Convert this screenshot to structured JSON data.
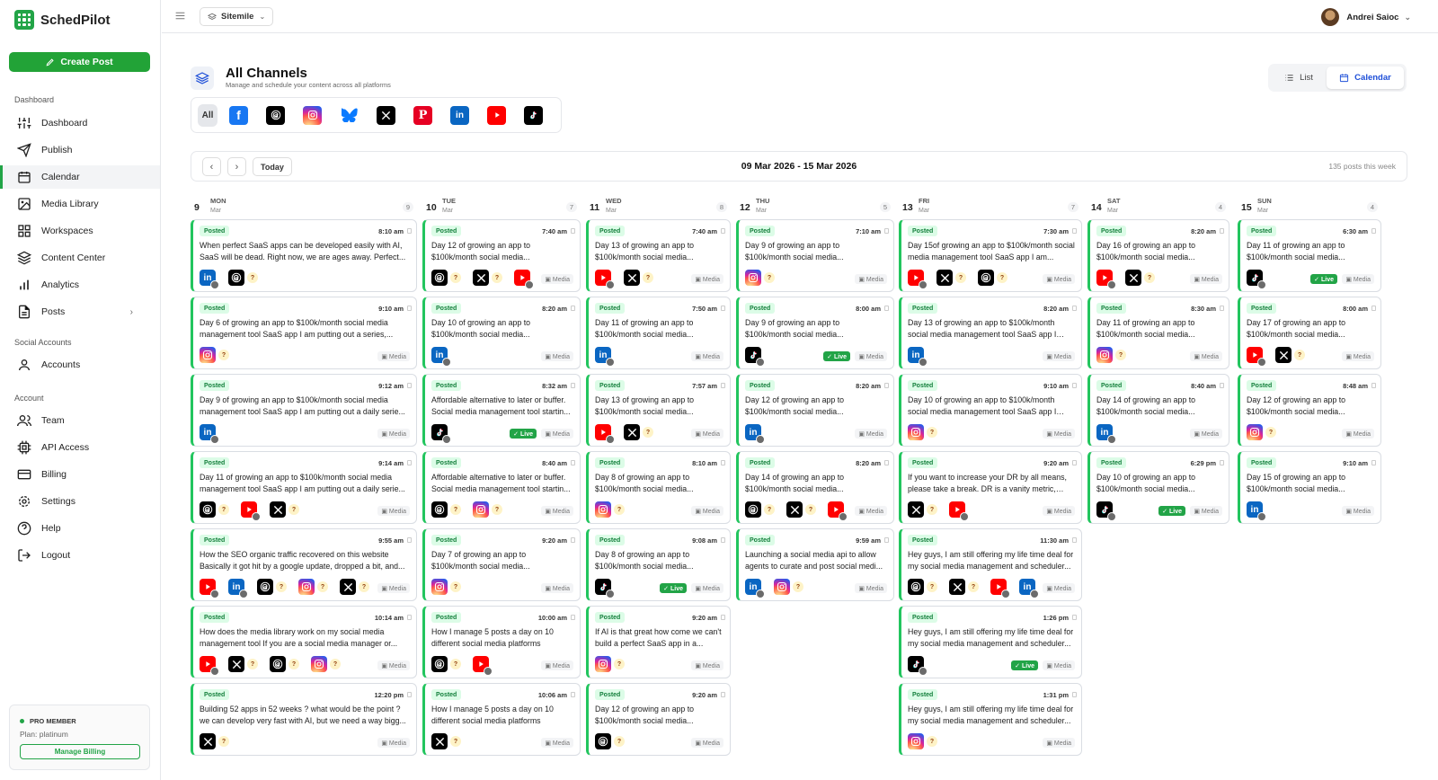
{
  "app": {
    "name": "SchedPilot",
    "create_label": "Create Post"
  },
  "nav": {
    "sections": [
      {
        "label": "Dashboard",
        "items": [
          {
            "key": "dashboard",
            "label": "Dashboard",
            "icon": "sliders-icon"
          },
          {
            "key": "publish",
            "label": "Publish",
            "icon": "send-icon"
          },
          {
            "key": "calendar",
            "label": "Calendar",
            "icon": "calendar-icon",
            "active": true
          },
          {
            "key": "media",
            "label": "Media Library",
            "icon": "image-icon"
          },
          {
            "key": "workspaces",
            "label": "Workspaces",
            "icon": "grid-icon"
          },
          {
            "key": "content",
            "label": "Content Center",
            "icon": "layers-icon"
          },
          {
            "key": "analytics",
            "label": "Analytics",
            "icon": "bar-chart-icon"
          },
          {
            "key": "posts",
            "label": "Posts",
            "icon": "file-icon",
            "chevron": true
          }
        ]
      },
      {
        "label": "Social Accounts",
        "items": [
          {
            "key": "accounts",
            "label": "Accounts",
            "icon": "user-icon"
          }
        ]
      },
      {
        "label": "Account",
        "items": [
          {
            "key": "team",
            "label": "Team",
            "icon": "users-icon"
          },
          {
            "key": "api",
            "label": "API Access",
            "icon": "cpu-icon"
          },
          {
            "key": "billing",
            "label": "Billing",
            "icon": "credit-card-icon"
          },
          {
            "key": "settings",
            "label": "Settings",
            "icon": "settings-icon"
          },
          {
            "key": "help",
            "label": "Help",
            "icon": "help-icon"
          },
          {
            "key": "logout",
            "label": "Logout",
            "icon": "logout-icon"
          }
        ]
      }
    ]
  },
  "pro": {
    "title": "PRO MEMBER",
    "plan": "Plan: platinum",
    "button": "Manage Billing"
  },
  "topbar": {
    "workspace": "Sitemile",
    "user": "Andrei Saioc"
  },
  "page": {
    "title": "All Channels",
    "subtitle": "Manage and schedule your content across all platforms"
  },
  "view": {
    "list": "List",
    "calendar": "Calendar",
    "active": "calendar"
  },
  "platforms": {
    "all_label": "All",
    "items": [
      "facebook",
      "threads",
      "instagram",
      "bluesky",
      "x",
      "pinterest",
      "linkedin",
      "youtube",
      "tiktok"
    ]
  },
  "calendar": {
    "today": "Today",
    "range": "09 Mar 2026 - 15 Mar 2026",
    "count": "135 posts this week"
  },
  "labels": {
    "posted": "Posted",
    "media": "Media",
    "live": "Live",
    "q": "?"
  },
  "colors": {
    "accent": "#22a447",
    "link": "#1d4ed8"
  },
  "days": [
    {
      "num": "9",
      "name": "MON",
      "month": "Mar",
      "count": "9",
      "posts": [
        {
          "time": "8:10 am",
          "text": "When perfect SaaS apps can be developed easily with AI, SaaS will be dead. Right now, we are ages away. Perfect...",
          "icons": [
            {
              "p": "linkedin",
              "a": true
            },
            {
              "p": "threads",
              "q": true
            }
          ],
          "media": false,
          "live": false
        },
        {
          "time": "9:10 am",
          "text": "Day 6 of growing an app to $100k/month social media management tool SaaS app I am putting out a series,...",
          "icons": [
            {
              "p": "instagram",
              "q": true
            }
          ],
          "media": true,
          "live": false
        },
        {
          "time": "9:12 am",
          "text": "Day 9 of growing an app to $100k/month social media management tool SaaS app I am putting out a daily serie...",
          "icons": [
            {
              "p": "linkedin",
              "a": true
            }
          ],
          "media": true,
          "live": false
        },
        {
          "time": "9:14 am",
          "text": "Day 11 of growing an app to $100k/month social media management tool SaaS app I am putting out a daily serie...",
          "icons": [
            {
              "p": "threads",
              "q": true
            },
            {
              "p": "youtube",
              "a": true
            },
            {
              "p": "x",
              "q": true
            }
          ],
          "media": true,
          "live": false
        },
        {
          "time": "9:55 am",
          "text": "How the SEO organic traffic recovered on this website Basically it got hit by a google update, dropped a bit, and...",
          "icons": [
            {
              "p": "youtube",
              "a": true
            },
            {
              "p": "linkedin",
              "a": true
            },
            {
              "p": "threads",
              "q": true
            },
            {
              "p": "instagram",
              "q": true
            },
            {
              "p": "x",
              "q": true
            }
          ],
          "media": true,
          "live": false
        },
        {
          "time": "10:14 am",
          "text": "How does the media library work on my social media management tool If you are a social media manager or...",
          "icons": [
            {
              "p": "youtube",
              "a": true
            },
            {
              "p": "x",
              "q": true
            },
            {
              "p": "threads",
              "q": true
            },
            {
              "p": "instagram",
              "q": true
            }
          ],
          "media": true,
          "live": false
        },
        {
          "time": "12:20 pm",
          "text": "Building 52 apps in 52 weeks ? what would be the point ? we can develop very fast with AI, but we need a way bigg...",
          "icons": [
            {
              "p": "x",
              "q": true
            }
          ],
          "media": true,
          "live": false
        }
      ]
    },
    {
      "num": "10",
      "name": "TUE",
      "month": "Mar",
      "count": "7",
      "posts": [
        {
          "time": "7:40 am",
          "text": "Day 12 of growing an app to $100k/month social media...",
          "icons": [
            {
              "p": "threads",
              "q": true
            },
            {
              "p": "x",
              "q": true
            },
            {
              "p": "youtube",
              "a": true
            }
          ],
          "media": true,
          "live": false
        },
        {
          "time": "8:20 am",
          "text": "Day 10 of growing an app to $100k/month social media...",
          "icons": [
            {
              "p": "linkedin",
              "a": true
            }
          ],
          "media": true,
          "live": false
        },
        {
          "time": "8:32 am",
          "text": "Affordable alternative to later or buffer. Social media management tool startin...",
          "icons": [
            {
              "p": "tiktok",
              "a": true
            }
          ],
          "media": true,
          "live": true
        },
        {
          "time": "8:40 am",
          "text": "Affordable alternative to later or buffer. Social media management tool startin...",
          "icons": [
            {
              "p": "threads",
              "q": true
            },
            {
              "p": "instagram",
              "q": true
            }
          ],
          "media": true,
          "live": false
        },
        {
          "time": "9:20 am",
          "text": "Day 7 of growing an app to $100k/month social media...",
          "icons": [
            {
              "p": "instagram",
              "q": true
            }
          ],
          "media": true,
          "live": false
        },
        {
          "time": "10:00 am",
          "text": "How I manage 5 posts a day on 10 different social media platforms",
          "icons": [
            {
              "p": "threads",
              "q": true
            },
            {
              "p": "youtube",
              "a": true
            }
          ],
          "media": true,
          "live": false
        },
        {
          "time": "10:06 am",
          "text": "How I manage 5 posts a day on 10 different social media platforms",
          "icons": [
            {
              "p": "x",
              "q": true
            }
          ],
          "media": true,
          "live": false
        }
      ]
    },
    {
      "num": "11",
      "name": "WED",
      "month": "Mar",
      "count": "8",
      "posts": [
        {
          "time": "7:40 am",
          "text": "Day 13 of growing an app to $100k/month social media...",
          "icons": [
            {
              "p": "youtube",
              "a": true
            },
            {
              "p": "x",
              "q": true
            }
          ],
          "media": true,
          "live": false
        },
        {
          "time": "7:50 am",
          "text": "Day 11 of growing an app to $100k/month social media...",
          "icons": [
            {
              "p": "linkedin",
              "a": true
            }
          ],
          "media": true,
          "live": false
        },
        {
          "time": "7:57 am",
          "text": "Day 13 of growing an app to $100k/month social media...",
          "icons": [
            {
              "p": "youtube",
              "a": true
            },
            {
              "p": "x",
              "q": true
            }
          ],
          "media": true,
          "live": false
        },
        {
          "time": "8:10 am",
          "text": "Day 8 of growing an app to $100k/month social media...",
          "icons": [
            {
              "p": "instagram",
              "q": true
            }
          ],
          "media": true,
          "live": false
        },
        {
          "time": "9:08 am",
          "text": "Day 8 of growing an app to $100k/month social media...",
          "icons": [
            {
              "p": "tiktok",
              "a": true
            }
          ],
          "media": true,
          "live": true
        },
        {
          "time": "9:20 am",
          "text": "If AI is that great how come we can't build a perfect SaaS app in a...",
          "icons": [
            {
              "p": "instagram",
              "q": true
            }
          ],
          "media": true,
          "live": false
        },
        {
          "time": "9:20 am",
          "text": "Day 12 of growing an app to $100k/month social media...",
          "icons": [
            {
              "p": "threads",
              "q": true
            }
          ],
          "media": true,
          "live": false
        }
      ]
    },
    {
      "num": "12",
      "name": "THU",
      "month": "Mar",
      "count": "5",
      "posts": [
        {
          "time": "7:10 am",
          "text": "Day 9 of growing an app to $100k/month social media...",
          "icons": [
            {
              "p": "instagram",
              "q": true
            }
          ],
          "media": true,
          "live": false
        },
        {
          "time": "8:00 am",
          "text": "Day 9 of growing an app to $100k/month social media...",
          "icons": [
            {
              "p": "tiktok",
              "a": true
            }
          ],
          "media": true,
          "live": true
        },
        {
          "time": "8:20 am",
          "text": "Day 12 of growing an app to $100k/month social media...",
          "icons": [
            {
              "p": "linkedin",
              "a": true
            }
          ],
          "media": true,
          "live": false
        },
        {
          "time": "8:20 am",
          "text": "Day 14 of growing an app to $100k/month social media...",
          "icons": [
            {
              "p": "threads",
              "q": true
            },
            {
              "p": "x",
              "q": true
            },
            {
              "p": "youtube",
              "a": true
            }
          ],
          "media": true,
          "live": false
        },
        {
          "time": "9:59 am",
          "text": "Launching a social media api to allow agents to curate and post social medi...",
          "icons": [
            {
              "p": "linkedin",
              "a": true
            },
            {
              "p": "instagram",
              "q": true
            }
          ],
          "media": true,
          "live": false
        }
      ]
    },
    {
      "num": "13",
      "name": "FRI",
      "month": "Mar",
      "count": "7",
      "posts": [
        {
          "time": "7:30 am",
          "text": "Day 15of growing an app to $100k/month social media management tool SaaS app I am...",
          "icons": [
            {
              "p": "youtube",
              "a": true
            },
            {
              "p": "x",
              "q": true
            },
            {
              "p": "threads",
              "q": true
            }
          ],
          "media": true,
          "live": false
        },
        {
          "time": "8:20 am",
          "text": "Day 13 of growing an app to $100k/month social media management tool SaaS app I am...",
          "icons": [
            {
              "p": "linkedin",
              "a": true
            }
          ],
          "media": true,
          "live": false
        },
        {
          "time": "9:10 am",
          "text": "Day 10 of growing an app to $100k/month social media management tool SaaS app I am...",
          "icons": [
            {
              "p": "instagram",
              "q": true
            }
          ],
          "media": true,
          "live": false
        },
        {
          "time": "9:20 am",
          "text": "If you want to increase your DR by all means, please take a break. DR is a vanity metric, and...",
          "icons": [
            {
              "p": "x",
              "q": true
            },
            {
              "p": "youtube",
              "a": true
            }
          ],
          "media": true,
          "live": false
        },
        {
          "time": "11:30 am",
          "text": "Hey guys, I am still offering my life time deal for my social media management and scheduler...",
          "icons": [
            {
              "p": "threads",
              "q": true
            },
            {
              "p": "x",
              "q": true
            },
            {
              "p": "youtube",
              "a": true
            },
            {
              "p": "linkedin",
              "a": true
            }
          ],
          "media": true,
          "live": false
        },
        {
          "time": "1:26 pm",
          "text": "Hey guys, I am still offering my life time deal for my social media management and scheduler...",
          "icons": [
            {
              "p": "tiktok",
              "a": true
            }
          ],
          "media": true,
          "live": true
        },
        {
          "time": "1:31 pm",
          "text": "Hey guys, I am still offering my life time deal for my social media management and scheduler...",
          "icons": [
            {
              "p": "instagram",
              "q": true
            }
          ],
          "media": true,
          "live": false
        }
      ]
    },
    {
      "num": "14",
      "name": "SAT",
      "month": "Mar",
      "count": "4",
      "posts": [
        {
          "time": "8:20 am",
          "text": "Day 16 of growing an app to $100k/month social media...",
          "icons": [
            {
              "p": "youtube",
              "a": true
            },
            {
              "p": "x",
              "q": true
            }
          ],
          "media": true,
          "live": false
        },
        {
          "time": "8:30 am",
          "text": "Day 11 of growing an app to $100k/month social media...",
          "icons": [
            {
              "p": "instagram",
              "q": true
            }
          ],
          "media": true,
          "live": false
        },
        {
          "time": "8:40 am",
          "text": "Day 14 of growing an app to $100k/month social media...",
          "icons": [
            {
              "p": "linkedin",
              "a": true
            }
          ],
          "media": true,
          "live": false
        },
        {
          "time": "6:29 pm",
          "text": "Day 10 of growing an app to $100k/month social media...",
          "icons": [
            {
              "p": "tiktok",
              "a": true
            }
          ],
          "media": true,
          "live": true
        }
      ]
    },
    {
      "num": "15",
      "name": "SUN",
      "month": "Mar",
      "count": "4",
      "posts": [
        {
          "time": "6:30 am",
          "text": "Day 11 of growing an app to $100k/month social media...",
          "icons": [
            {
              "p": "tiktok",
              "a": true
            }
          ],
          "media": true,
          "live": true
        },
        {
          "time": "8:00 am",
          "text": "Day 17 of growing an app to $100k/month social media...",
          "icons": [
            {
              "p": "youtube",
              "a": true
            },
            {
              "p": "x",
              "q": true
            }
          ],
          "media": true,
          "live": false
        },
        {
          "time": "8:48 am",
          "text": "Day 12 of growing an app to $100k/month social media...",
          "icons": [
            {
              "p": "instagram",
              "q": true
            }
          ],
          "media": true,
          "live": false
        },
        {
          "time": "9:10 am",
          "text": "Day 15 of growing an app to $100k/month social media...",
          "icons": [
            {
              "p": "linkedin",
              "a": true
            }
          ],
          "media": true,
          "live": false
        }
      ]
    }
  ]
}
